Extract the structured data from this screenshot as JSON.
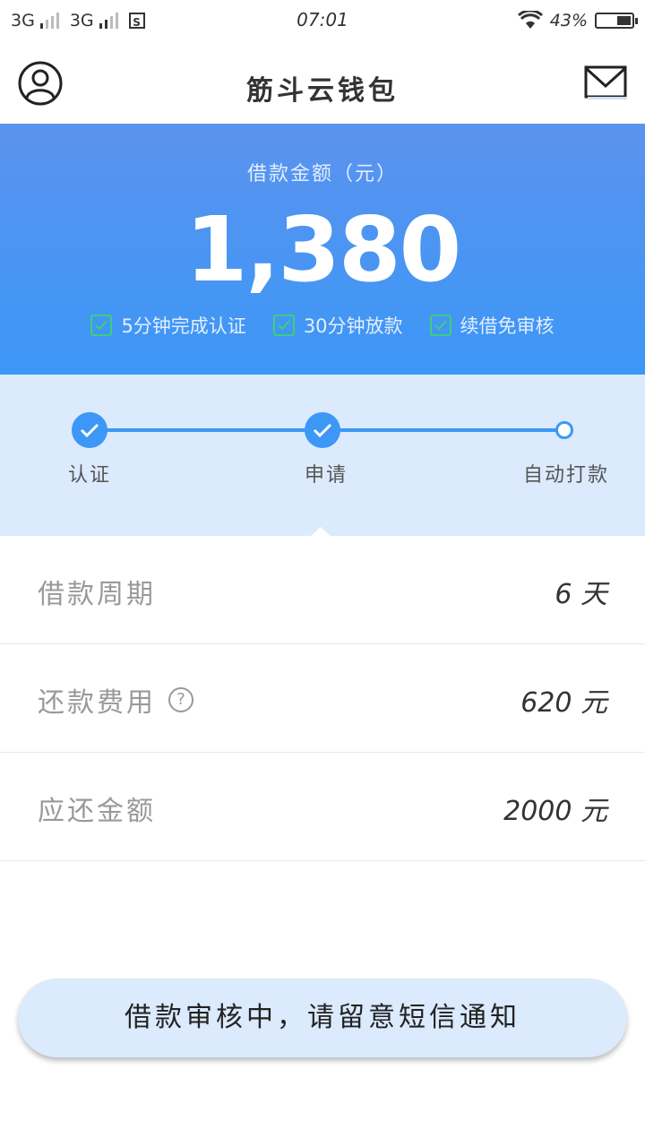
{
  "status_bar": {
    "sim1": "3G",
    "sim2": "3G",
    "time": "07:01",
    "battery": "43%",
    "battery_level": 0.43
  },
  "header": {
    "title": "筋斗云钱包",
    "left_icon": "user-avatar-icon",
    "right_icon": "mail-icon"
  },
  "loan": {
    "label": "借款金额（元）",
    "amount": "1,380",
    "features": [
      "5分钟完成认证",
      "30分钟放款",
      "续借免审核"
    ]
  },
  "progress": {
    "steps": [
      {
        "label": "认证",
        "done": true
      },
      {
        "label": "申请",
        "done": true
      },
      {
        "label": "自动打款",
        "done": false
      }
    ]
  },
  "details": {
    "rows": [
      {
        "label": "借款周期",
        "value": "6 天"
      },
      {
        "label": "还款费用",
        "value": "620 元",
        "help": "?"
      },
      {
        "label": "应还金额",
        "value": "2000 元"
      }
    ]
  },
  "status_button": {
    "label": "借款审核中，请留意短信通知"
  },
  "colors": {
    "primary": "#3c97f6",
    "hero_top": "#5b93ef",
    "check_green": "#3cd07a",
    "light_blue_bg": "#dbeafc"
  }
}
